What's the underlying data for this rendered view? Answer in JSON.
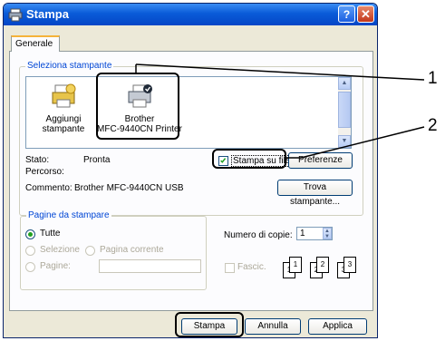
{
  "window": {
    "title": "Stampa",
    "help_label": "?",
    "close_label": "✕"
  },
  "tab": {
    "label": "Generale"
  },
  "select_printer": {
    "legend": "Seleziona stampante",
    "printers": [
      {
        "label_line1": "Aggiungi",
        "label_line2": "stampante",
        "icon": "add-printer-icon"
      },
      {
        "label_line1": "Brother",
        "label_line2": "MFC-9440CN Printer",
        "icon": "printer-icon",
        "selected": true
      }
    ]
  },
  "status": {
    "stato_label": "Stato:",
    "stato_value": "Pronta",
    "percorso_label": "Percorso:",
    "commento_label": "Commento:",
    "commento_value": "Brother MFC-9440CN USB"
  },
  "print_to_file": {
    "label": "Stampa su file",
    "checked": true
  },
  "buttons": {
    "preferenze": "Preferenze",
    "trova": "Trova stampante...",
    "stampa": "Stampa",
    "annulla": "Annulla",
    "applica": "Applica"
  },
  "page_range": {
    "legend": "Pagine da stampare",
    "tutte": "Tutte",
    "selezione": "Selezione",
    "pagina_corrente": "Pagina corrente",
    "pagine": "Pagine:"
  },
  "copies": {
    "label": "Numero di copie:",
    "value": "1",
    "fascicola_label": "Fascic.",
    "collate_pages": [
      "1",
      "1",
      "2",
      "2",
      "3",
      "3"
    ]
  },
  "callouts": {
    "one": "1",
    "two": "2"
  },
  "colors": {
    "title_blue": "#0a5bd8",
    "legend_blue": "#0046d5",
    "dialog_bg": "#ece9d8"
  }
}
